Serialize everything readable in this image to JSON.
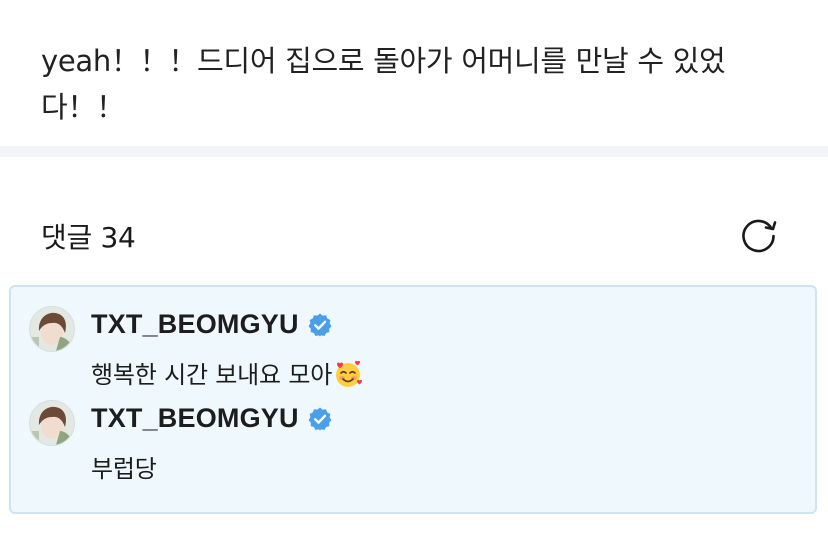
{
  "post": {
    "text": "yeah！！！드디어 집으로 돌아가 어머니를 만날 수 있었다！！"
  },
  "comments_section": {
    "title": "댓글 34",
    "refresh_icon": "refresh-icon"
  },
  "comments": [
    {
      "author": "TXT_BEOMGYU",
      "verified": true,
      "text": "행복한 시간 보내요 모아",
      "emoji": "smiling-face-with-hearts"
    },
    {
      "author": "TXT_BEOMGYU",
      "verified": true,
      "text": "부럽당"
    }
  ],
  "colors": {
    "verified_badge": "#4a9fe8",
    "comment_bg": "#eef8fd",
    "comment_border": "#cfe3f0",
    "divider": "#f2f4f7"
  }
}
